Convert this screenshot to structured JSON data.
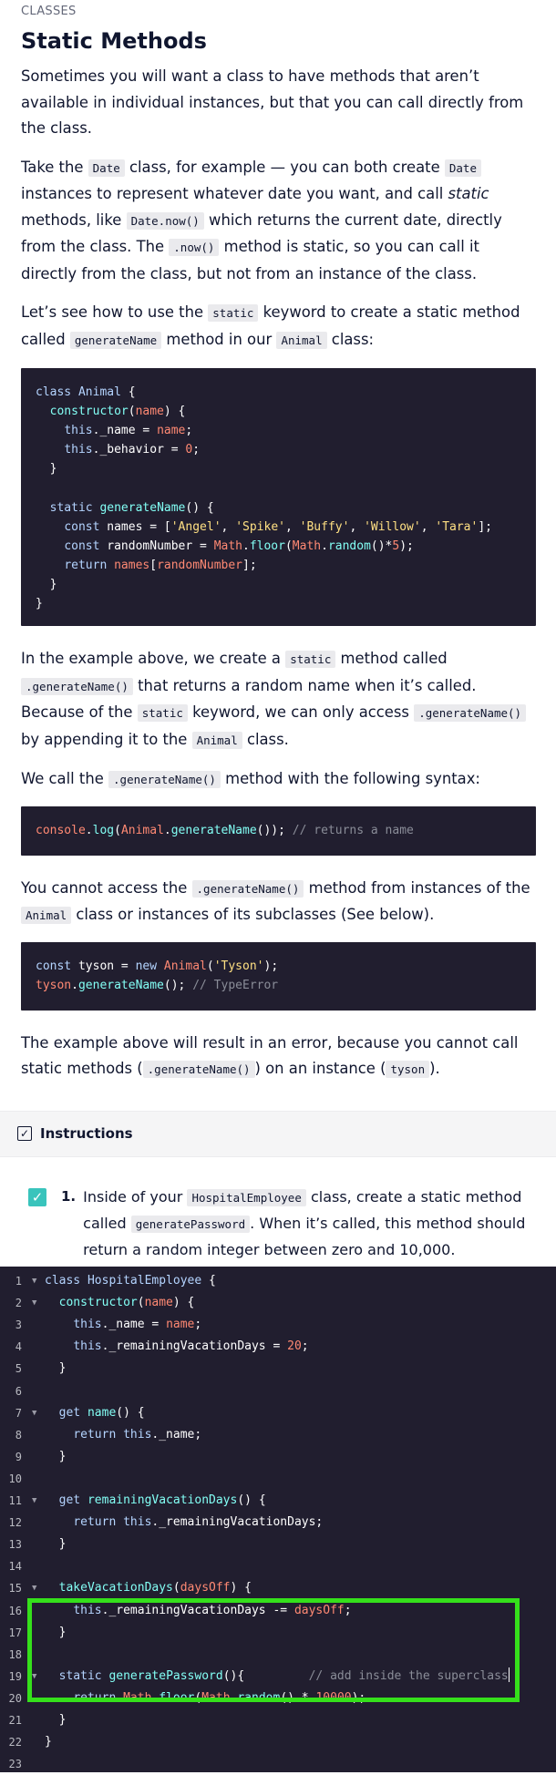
{
  "lesson": {
    "eyebrow": "CLASSES",
    "title": "Static Methods",
    "p1": "Sometimes you will want a class to have methods that aren’t available in individual instances, but that you can call directly from the class.",
    "p2": {
      "a": "Take the ",
      "code1": "Date",
      "b": " class, for example — you can both create ",
      "code2": "Date",
      "c": " instances to represent whatever date you want, and call ",
      "em": "static",
      "d": " methods, like ",
      "code3": "Date.now()",
      "e": " which returns the current date, directly from the class. The ",
      "code4": ".now()",
      "f": " method is static, so you can call it directly from the class, but not from an instance of the class."
    },
    "p3": {
      "a": "Let’s see how to use the ",
      "code1": "static",
      "b": " keyword to create a static method called ",
      "code2": "generateName",
      "c": " method in our ",
      "code3": "Animal",
      "d": " class:"
    },
    "p4": {
      "a": "In the example above, we create a ",
      "code1": "static",
      "b": " method called ",
      "code2": ".generateName()",
      "c": " that returns a random name when it’s called. Because of the ",
      "code3": "static",
      "d": " keyword, we can only access ",
      "code4": ".generateName()",
      "e": " by appending it to the ",
      "code5": "Animal",
      "f": " class."
    },
    "p5": {
      "a": "We call the ",
      "code1": ".generateName()",
      "b": " method with the following syntax:"
    },
    "p6": {
      "a": "You cannot access the ",
      "code1": ".generateName()",
      "b": " method from instances of the ",
      "code2": "Animal",
      "c": " class or instances of its subclasses (See below)."
    },
    "p7": {
      "a": "The example above will result in an error, because you cannot call static methods (",
      "code1": ".generateName()",
      "b": ") on an instance (",
      "code2": "tyson",
      "c": ")."
    }
  },
  "code_examples": {
    "animal_class": [
      [
        [
          "kw",
          "class "
        ],
        [
          "kw",
          "Animal"
        ],
        [
          "w",
          " {"
        ]
      ],
      [
        [
          "w",
          "  "
        ],
        [
          "fn",
          "constructor"
        ],
        [
          "w",
          "("
        ],
        [
          "v",
          "name"
        ],
        [
          "w",
          ") {"
        ]
      ],
      [
        [
          "w",
          "    "
        ],
        [
          "kw",
          "this"
        ],
        [
          "w",
          "._name = "
        ],
        [
          "v",
          "name"
        ],
        [
          "w",
          ";"
        ]
      ],
      [
        [
          "w",
          "    "
        ],
        [
          "kw",
          "this"
        ],
        [
          "w",
          "._behavior = "
        ],
        [
          "n",
          "0"
        ],
        [
          "w",
          ";"
        ]
      ],
      [
        [
          "w",
          "  }"
        ]
      ],
      [
        [
          "w",
          ""
        ]
      ],
      [
        [
          "w",
          "  "
        ],
        [
          "kw",
          "static "
        ],
        [
          "fn",
          "generateName"
        ],
        [
          "w",
          "() {"
        ]
      ],
      [
        [
          "w",
          "    "
        ],
        [
          "kw",
          "const "
        ],
        [
          "w",
          "names = ["
        ],
        [
          "s",
          "'Angel'"
        ],
        [
          "w",
          ", "
        ],
        [
          "s",
          "'Spike'"
        ],
        [
          "w",
          ", "
        ],
        [
          "s",
          "'Buffy'"
        ],
        [
          "w",
          ", "
        ],
        [
          "s",
          "'Willow'"
        ],
        [
          "w",
          ", "
        ],
        [
          "s",
          "'Tara'"
        ],
        [
          "w",
          "];"
        ]
      ],
      [
        [
          "w",
          "    "
        ],
        [
          "kw",
          "const "
        ],
        [
          "w",
          "randomNumber = "
        ],
        [
          "v",
          "Math"
        ],
        [
          "w",
          "."
        ],
        [
          "fn",
          "floor"
        ],
        [
          "w",
          "("
        ],
        [
          "v",
          "Math"
        ],
        [
          "w",
          "."
        ],
        [
          "fn",
          "random"
        ],
        [
          "w",
          "()*"
        ],
        [
          "n",
          "5"
        ],
        [
          "w",
          ");"
        ]
      ],
      [
        [
          "w",
          "    "
        ],
        [
          "kw",
          "return "
        ],
        [
          "v",
          "names"
        ],
        [
          "w",
          "["
        ],
        [
          "v",
          "randomNumber"
        ],
        [
          "w",
          "];"
        ]
      ],
      [
        [
          "w",
          "  }"
        ]
      ],
      [
        [
          "w",
          "}"
        ]
      ]
    ],
    "call_example": [
      [
        [
          "v",
          "console"
        ],
        [
          "w",
          "."
        ],
        [
          "fn",
          "log"
        ],
        [
          "w",
          "("
        ],
        [
          "v",
          "Animal"
        ],
        [
          "w",
          "."
        ],
        [
          "fn",
          "generateName"
        ],
        [
          "w",
          "()); "
        ],
        [
          "c",
          "// returns a name"
        ]
      ]
    ],
    "instance_example": [
      [
        [
          "kw",
          "const "
        ],
        [
          "w",
          "tyson = "
        ],
        [
          "kw",
          "new "
        ],
        [
          "v",
          "Animal"
        ],
        [
          "w",
          "("
        ],
        [
          "s",
          "'Tyson'"
        ],
        [
          "w",
          ");"
        ]
      ],
      [
        [
          "v",
          "tyson"
        ],
        [
          "w",
          "."
        ],
        [
          "fn",
          "generateName"
        ],
        [
          "w",
          "(); "
        ],
        [
          "c",
          "// TypeError"
        ]
      ]
    ]
  },
  "instructions": {
    "title": "Instructions",
    "task_number": "1.",
    "task": {
      "a": "Inside of your ",
      "code1": "HospitalEmployee",
      "b": " class, create a static method called ",
      "code2": "generatePassword",
      "c": ". When it’s called, this method should return a random integer between zero and 10,000."
    }
  },
  "editor": {
    "lines": [
      {
        "n": "1",
        "fold": true,
        "t": [
          [
            "kw",
            "class "
          ],
          [
            "kw",
            "HospitalEmployee"
          ],
          [
            "w",
            " {"
          ]
        ]
      },
      {
        "n": "2",
        "fold": true,
        "t": [
          [
            "w",
            "  "
          ],
          [
            "fn",
            "constructor"
          ],
          [
            "w",
            "("
          ],
          [
            "v",
            "name"
          ],
          [
            "w",
            ") {"
          ]
        ]
      },
      {
        "n": "3",
        "fold": false,
        "t": [
          [
            "w",
            "    "
          ],
          [
            "kw",
            "this"
          ],
          [
            "w",
            "._name = "
          ],
          [
            "v",
            "name"
          ],
          [
            "w",
            ";"
          ]
        ]
      },
      {
        "n": "4",
        "fold": false,
        "t": [
          [
            "w",
            "    "
          ],
          [
            "kw",
            "this"
          ],
          [
            "w",
            "._remainingVacationDays = "
          ],
          [
            "n",
            "20"
          ],
          [
            "w",
            ";"
          ]
        ]
      },
      {
        "n": "5",
        "fold": false,
        "t": [
          [
            "w",
            "  }"
          ]
        ]
      },
      {
        "n": "6",
        "fold": false,
        "t": [
          [
            "w",
            ""
          ]
        ]
      },
      {
        "n": "7",
        "fold": true,
        "t": [
          [
            "w",
            "  "
          ],
          [
            "kw",
            "get "
          ],
          [
            "fn",
            "name"
          ],
          [
            "w",
            "() {"
          ]
        ]
      },
      {
        "n": "8",
        "fold": false,
        "t": [
          [
            "w",
            "    "
          ],
          [
            "kw",
            "return this"
          ],
          [
            "w",
            "._name;"
          ]
        ]
      },
      {
        "n": "9",
        "fold": false,
        "t": [
          [
            "w",
            "  }"
          ]
        ]
      },
      {
        "n": "10",
        "fold": false,
        "t": [
          [
            "w",
            ""
          ]
        ]
      },
      {
        "n": "11",
        "fold": true,
        "t": [
          [
            "w",
            "  "
          ],
          [
            "kw",
            "get "
          ],
          [
            "fn",
            "remainingVacationDays"
          ],
          [
            "w",
            "() {"
          ]
        ]
      },
      {
        "n": "12",
        "fold": false,
        "t": [
          [
            "w",
            "    "
          ],
          [
            "kw",
            "return this"
          ],
          [
            "w",
            "._remainingVacationDays;"
          ]
        ]
      },
      {
        "n": "13",
        "fold": false,
        "t": [
          [
            "w",
            "  }"
          ]
        ]
      },
      {
        "n": "14",
        "fold": false,
        "t": [
          [
            "w",
            ""
          ]
        ]
      },
      {
        "n": "15",
        "fold": true,
        "t": [
          [
            "w",
            "  "
          ],
          [
            "fn",
            "takeVacationDays"
          ],
          [
            "w",
            "("
          ],
          [
            "v",
            "daysOff"
          ],
          [
            "w",
            ") {"
          ]
        ]
      },
      {
        "n": "16",
        "fold": false,
        "t": [
          [
            "w",
            "    "
          ],
          [
            "kw",
            "this"
          ],
          [
            "w",
            "._remainingVacationDays -= "
          ],
          [
            "v",
            "daysOff"
          ],
          [
            "w",
            ";"
          ]
        ]
      },
      {
        "n": "17",
        "fold": false,
        "t": [
          [
            "w",
            "  }"
          ]
        ]
      },
      {
        "n": "18",
        "fold": false,
        "t": [
          [
            "w",
            ""
          ]
        ]
      },
      {
        "n": "19",
        "fold": true,
        "t": [
          [
            "w",
            "  "
          ],
          [
            "kw",
            "static "
          ],
          [
            "fn",
            "generatePassword"
          ],
          [
            "w",
            "(){         "
          ],
          [
            "c",
            "// add inside the superclass"
          ]
        ]
      },
      {
        "n": "20",
        "fold": false,
        "t": [
          [
            "w",
            "    "
          ],
          [
            "kw",
            "return "
          ],
          [
            "v",
            "Math"
          ],
          [
            "w",
            "."
          ],
          [
            "fn",
            "floor"
          ],
          [
            "w",
            "("
          ],
          [
            "v",
            "Math"
          ],
          [
            "w",
            "."
          ],
          [
            "fn",
            "random"
          ],
          [
            "w",
            "() * "
          ],
          [
            "n",
            "10000"
          ],
          [
            "w",
            ");"
          ]
        ]
      },
      {
        "n": "21",
        "fold": false,
        "t": [
          [
            "w",
            "  }"
          ]
        ]
      },
      {
        "n": "22",
        "fold": false,
        "t": [
          [
            "w",
            "}"
          ]
        ]
      },
      {
        "n": "23",
        "fold": false,
        "t": [
          [
            "w",
            ""
          ]
        ]
      }
    ]
  }
}
